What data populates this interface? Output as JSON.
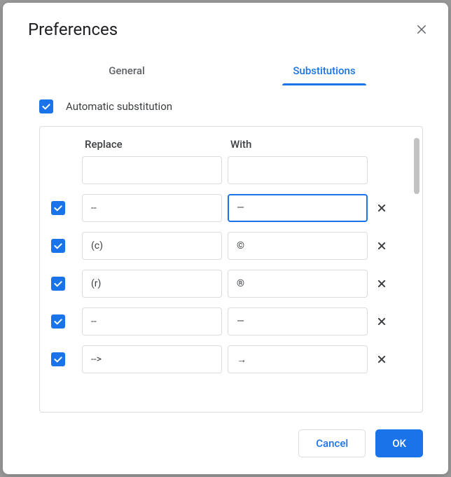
{
  "dialog": {
    "title": "Preferences",
    "tabs": {
      "general": "General",
      "substitutions": "Substitutions"
    },
    "auto_substitution_label": "Automatic substitution",
    "headers": {
      "replace": "Replace",
      "with": "With"
    },
    "rows": [
      {
        "checked": false,
        "replace": "",
        "with": "",
        "focused": false,
        "deletable": false
      },
      {
        "checked": true,
        "replace": "--",
        "with": "—",
        "focused": true,
        "deletable": true
      },
      {
        "checked": true,
        "replace": "(c)",
        "with": "©",
        "focused": false,
        "deletable": true
      },
      {
        "checked": true,
        "replace": "(r)",
        "with": "®",
        "focused": false,
        "deletable": true
      },
      {
        "checked": true,
        "replace": "--",
        "with": "—",
        "focused": false,
        "deletable": true
      },
      {
        "checked": true,
        "replace": "-->",
        "with": "→",
        "focused": false,
        "deletable": true
      }
    ],
    "buttons": {
      "cancel": "Cancel",
      "ok": "OK"
    }
  }
}
